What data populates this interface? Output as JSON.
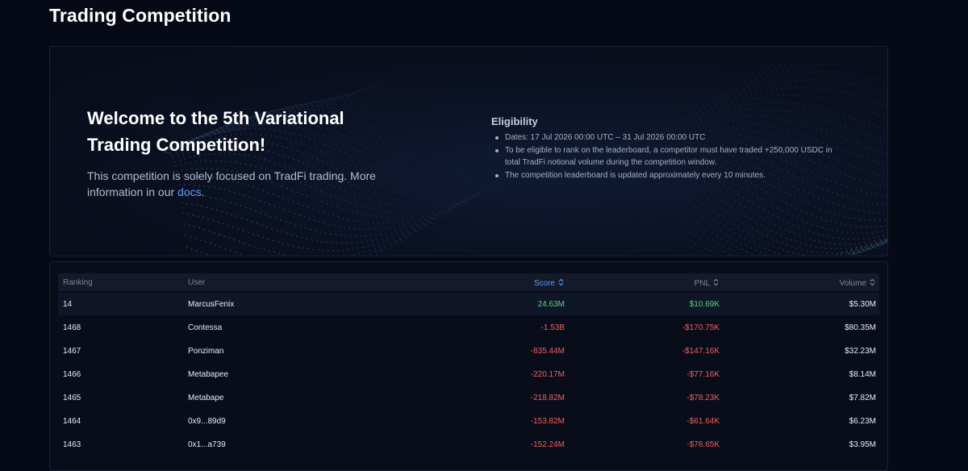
{
  "page": {
    "title": "Trading Competition"
  },
  "hero": {
    "heading": "Welcome to the 5th Variational Trading Competition!",
    "description_prefix": "This competition is solely focused on TradFi trading. More information in our ",
    "docs_link": "docs",
    "description_suffix": "."
  },
  "eligibility": {
    "title": "Eligibility",
    "items": [
      "Dates: 17 Jul 2026 00:00 UTC – 31 Jul 2026 00:00 UTC",
      "To be eligible to rank on the leaderboard, a competitor must have traded +250,000 USDC in total TradFi notional volume during the competition window.",
      "The competition leaderboard is updated approximately every 10 minutes."
    ]
  },
  "leaderboard": {
    "columns": {
      "ranking": "Ranking",
      "user": "User",
      "score": "Score",
      "pnl": "PNL",
      "volume": "Volume"
    },
    "active_sort": "score",
    "rows": [
      {
        "ranking": "14",
        "user": "MarcusFenix",
        "score": "24.63M",
        "pnl": "$10.69K",
        "volume": "$5.30M",
        "sign": "pos",
        "highlight": true
      },
      {
        "ranking": "1468",
        "user": "Contessa",
        "score": "-1.53B",
        "pnl": "-$170.75K",
        "volume": "$80.35M",
        "sign": "neg"
      },
      {
        "ranking": "1467",
        "user": "Ponziman",
        "score": "-835.44M",
        "pnl": "-$147.16K",
        "volume": "$32.23M",
        "sign": "neg"
      },
      {
        "ranking": "1466",
        "user": "Metabapee",
        "score": "-220.17M",
        "pnl": "-$77.16K",
        "volume": "$8.14M",
        "sign": "neg"
      },
      {
        "ranking": "1465",
        "user": "Metabape",
        "score": "-218.82M",
        "pnl": "-$78.23K",
        "volume": "$7.82M",
        "sign": "neg"
      },
      {
        "ranking": "1464",
        "user": "0x9...89d9",
        "score": "-153.82M",
        "pnl": "-$61.64K",
        "volume": "$6.23M",
        "sign": "neg"
      },
      {
        "ranking": "1463",
        "user": "0x1...a739",
        "score": "-152.24M",
        "pnl": "-$76.65K",
        "volume": "$3.95M",
        "sign": "neg"
      }
    ]
  },
  "colors": {
    "background": "#060a17",
    "positive": "#5fd37a",
    "negative": "#f0605e",
    "link": "#5a9cf5"
  }
}
